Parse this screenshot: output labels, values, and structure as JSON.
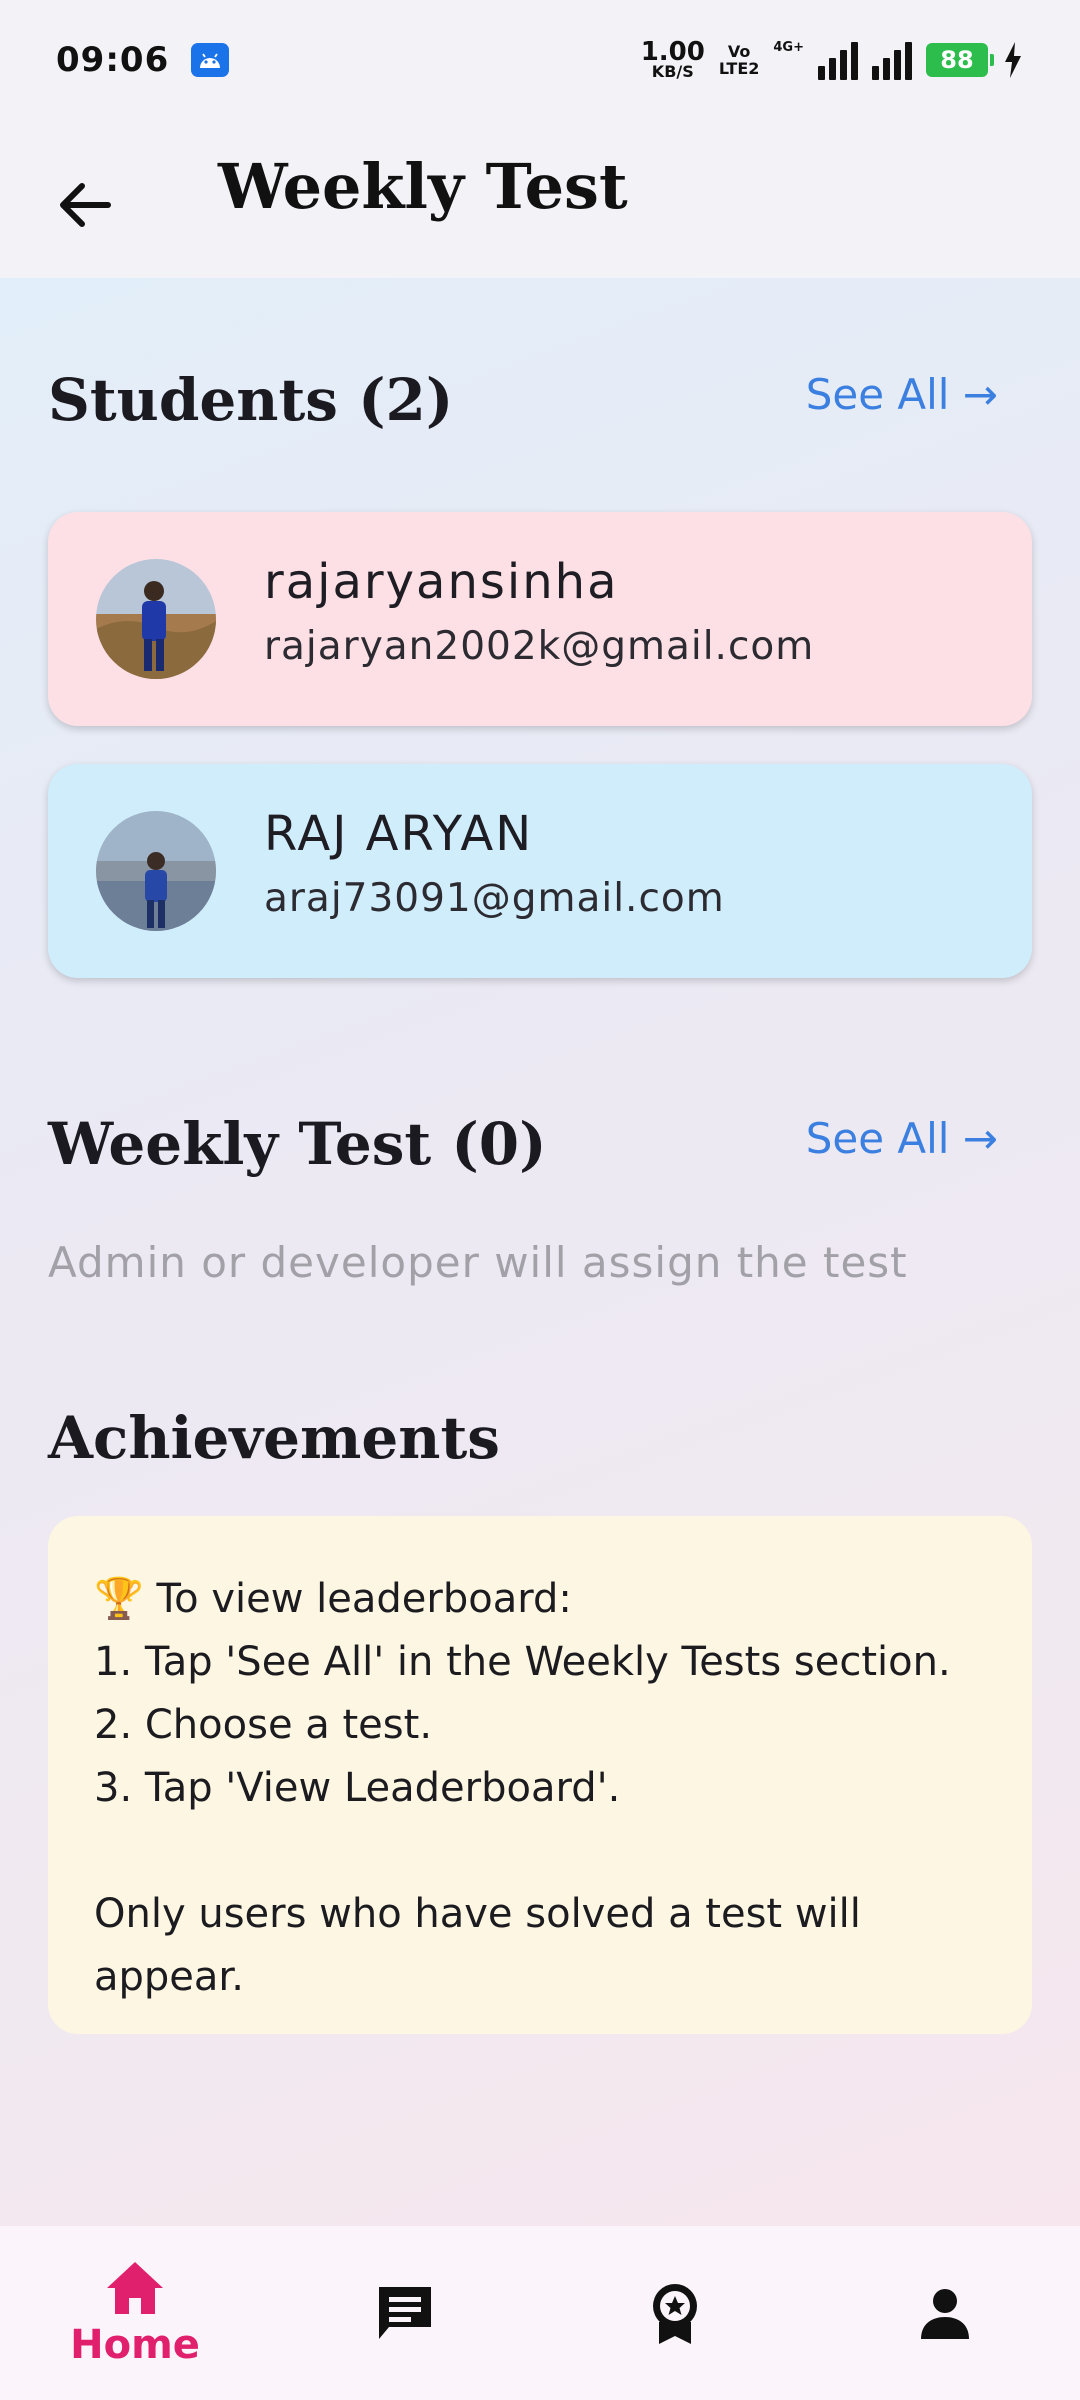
{
  "status_bar": {
    "time": "09:06",
    "net_speed_value": "1.00",
    "net_speed_unit": "KB/S",
    "volte_top": "Vo",
    "volte_bottom": "LTE2",
    "network_type": "4G+",
    "battery": "88"
  },
  "app_bar": {
    "title": "Weekly Test"
  },
  "students_section": {
    "heading": "Students (2)",
    "see_all": "See All →",
    "students": [
      {
        "name": "rajaryansinha",
        "email": "rajaryan2002k@gmail.com",
        "card_color": "#fde0e5"
      },
      {
        "name": "RAJ ARYAN",
        "email": "araj73091@gmail.com",
        "card_color": "#d0edfb"
      }
    ]
  },
  "weekly_test_section": {
    "heading": "Weekly Test (0)",
    "see_all": "See All →",
    "empty_message": "Admin or developer will assign the test"
  },
  "achievements_section": {
    "heading": "Achievements",
    "card": {
      "line1": "🏆 To view leaderboard:",
      "line2": "1. Tap 'See All' in the Weekly Tests section.",
      "line3": "2. Choose a test.",
      "line4": "3. Tap 'View Leaderboard'.",
      "line5": "Only users who have solved a test will",
      "line6": "appear."
    }
  },
  "bottom_nav": {
    "active_color": "#e0206d",
    "items": [
      {
        "label": "Home",
        "icon": "home-icon",
        "active": true
      },
      {
        "label": "",
        "icon": "chat-icon",
        "active": false
      },
      {
        "label": "",
        "icon": "award-icon",
        "active": false
      },
      {
        "label": "",
        "icon": "person-icon",
        "active": false
      }
    ]
  }
}
